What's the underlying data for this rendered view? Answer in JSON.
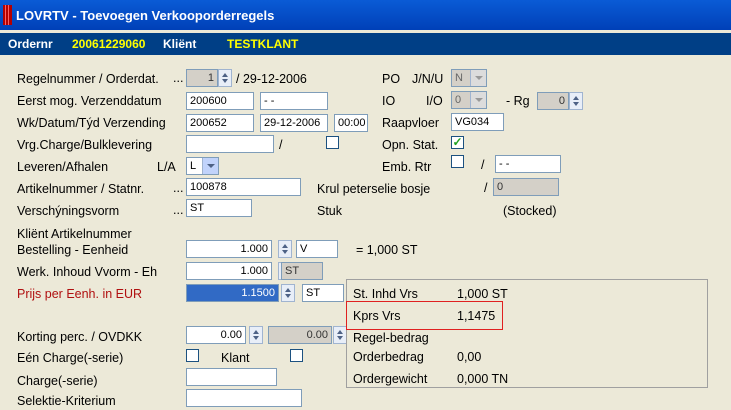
{
  "window": {
    "title": "LOVRTV - Toevoegen Verkooporderregels"
  },
  "header": {
    "ordernr_label": "Ordernr",
    "ordernr_value": "20061229060",
    "klient_label": "Kliënt",
    "klient_value": "TESTKLANT"
  },
  "form": {
    "regelnummer": {
      "label": "Regelnummer / Orderdat.",
      "dots": "...",
      "value": "1",
      "date": "/ 29-12-2006"
    },
    "eerst": {
      "label": "Eerst mog. Verzenddatum",
      "value": "200600",
      "date": "- -"
    },
    "wk": {
      "label": "Wk/Datum/Týd Verzending",
      "week": "200652",
      "date": "29-12-2006",
      "time": "00:00"
    },
    "vrg": {
      "label": "Vrg.Charge/Bulklevering",
      "slash": "/",
      "checked": false
    },
    "leveren": {
      "label": "Leveren/Afhalen",
      "la": "L/A",
      "value": "L"
    },
    "artikel": {
      "label": "Artikelnummer / Statnr.",
      "dots": "...",
      "value": "100878"
    },
    "verschijning": {
      "label": "Verschýningsvorm",
      "dots": "...",
      "value": "ST"
    },
    "klient_artikel": {
      "label": "Kliënt Artikelnummer"
    },
    "bestelling": {
      "label": "Bestelling - Eenheid",
      "value": "1.000",
      "unit": "V",
      "equals": "= 1,000 ST"
    },
    "werk": {
      "label": "Werk. Inhoud Vvorm - Eh",
      "value": "1.000",
      "unit": "ST"
    },
    "prijs": {
      "label": "Prijs per Eenh. in EUR",
      "value": "1.1500",
      "unit": "ST"
    },
    "korting": {
      "label": "Korting perc. / OVDKK",
      "value": "0.00",
      "value2": "0.00"
    },
    "een_charge": {
      "label": "Eén Charge(-serie)",
      "checked": false,
      "klant_label": "Klant",
      "klant_checked": false
    },
    "charge": {
      "label": "Charge(-serie)",
      "value": ""
    },
    "selektie": {
      "label": "Selektie-Kriterium",
      "value": ""
    }
  },
  "right": {
    "po": {
      "label": "PO",
      "jnu": "J/N/U",
      "value": "N"
    },
    "io": {
      "label": "IO",
      "io2": "I/O",
      "value": "0",
      "rg_label": "- Rg",
      "rg_value": "0"
    },
    "raapvloer": {
      "label": "Raapvloer",
      "value": "VG034"
    },
    "opn": {
      "label": "Opn. Stat.",
      "checked": true
    },
    "emb": {
      "label": "Emb. Rtr",
      "slash": "/",
      "value": "- -"
    },
    "krul": {
      "label": "Krul peterselie bosje",
      "slash": "/",
      "value": "0"
    },
    "stuk": {
      "label": "Stuk",
      "stocked": "(Stocked)"
    }
  },
  "info": {
    "st_inhd": {
      "label": "St. Inhd Vrs",
      "value": "1,000 ST"
    },
    "kprs": {
      "label": "Kprs Vrs",
      "value": "1,1475"
    },
    "regel": {
      "label": "Regel-bedrag",
      "value": ""
    },
    "order": {
      "label": "Orderbedrag",
      "value": "0,00"
    },
    "gewicht": {
      "label": "Ordergewicht",
      "value": "0,000 TN"
    }
  },
  "colors": {
    "title_bar": "#0a5bd6",
    "header_bar": "#003f86",
    "header_value": "#ffff00",
    "highlight": "#e02020",
    "price_label": "#b01010"
  }
}
